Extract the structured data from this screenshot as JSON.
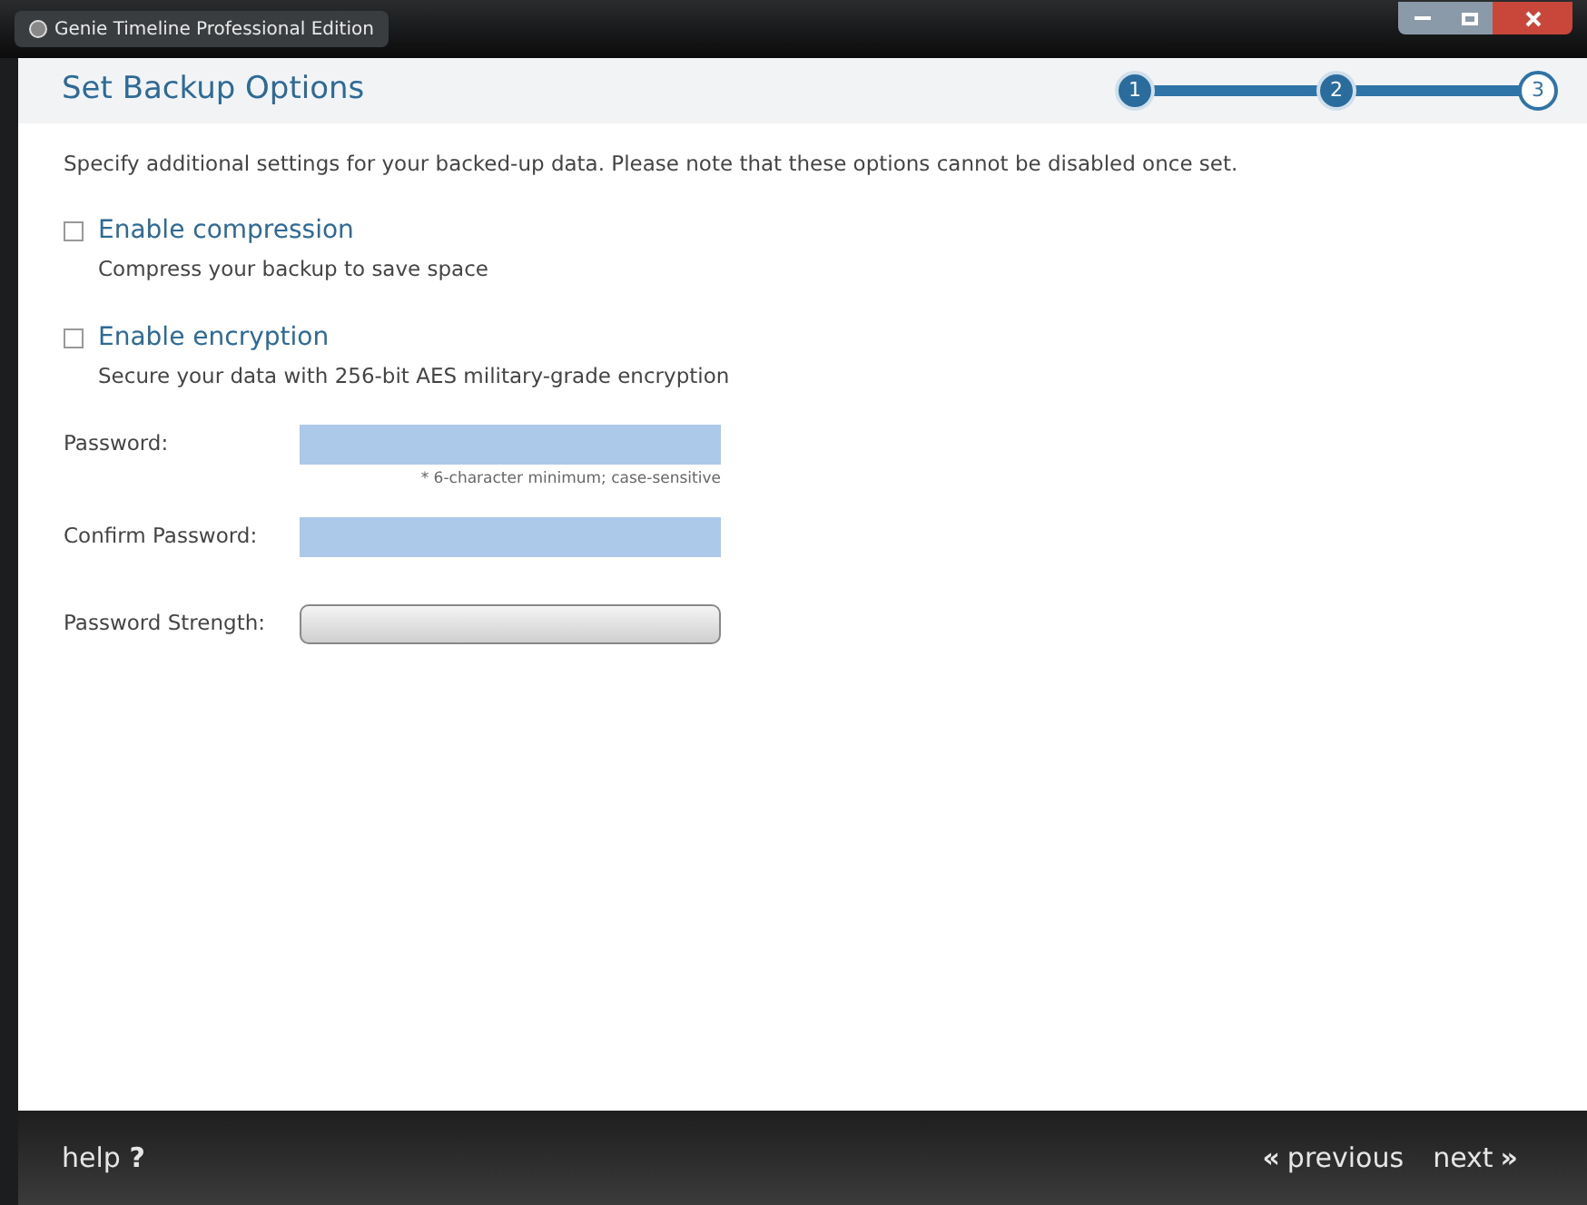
{
  "window": {
    "title": "Genie Timeline Professional Edition"
  },
  "header": {
    "title": "Set Backup Options",
    "steps": [
      {
        "label": "1",
        "selected": false
      },
      {
        "label": "2",
        "selected": false
      },
      {
        "label": "3",
        "selected": true
      }
    ]
  },
  "intro": "Specify additional settings for your backed-up data. Please note that these options cannot be disabled once set.",
  "options": [
    {
      "label": "Enable compression",
      "description": "Compress your backup to save space",
      "checked": false
    },
    {
      "label": "Enable encryption",
      "description": "Secure your data with 256-bit AES military-grade encryption",
      "checked": false
    }
  ],
  "password": {
    "label": "Password:",
    "hint": "* 6-character minimum; case-sensitive"
  },
  "confirm": {
    "label": "Confirm Password:"
  },
  "strength": {
    "label": "Password Strength:",
    "level": 0
  },
  "footer": {
    "help": "help **?**",
    "previous": {
      "glyph": "«",
      "label": "previous"
    },
    "next": {
      "label": "next",
      "glyph": "»"
    }
  }
}
